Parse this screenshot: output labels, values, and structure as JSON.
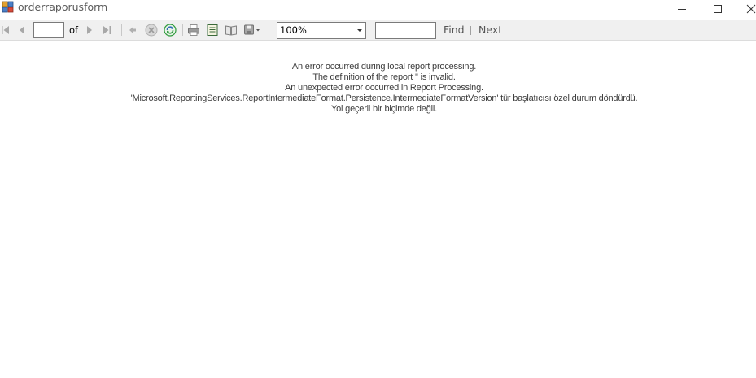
{
  "window": {
    "title": "orderraporusform",
    "icon": "form-app-icon",
    "controls": [
      "minimize-icon",
      "maximize-icon",
      "close-icon"
    ]
  },
  "toolbar": {
    "page_value": "",
    "of_label": "of",
    "zoom_value": "100%",
    "find_value": "",
    "find_label": "Find",
    "next_label": "Next",
    "icons": [
      "first-page-icon",
      "previous-page-icon",
      "next-page-icon",
      "last-page-icon",
      "back-icon",
      "stop-icon",
      "refresh-icon",
      "print-icon",
      "print-layout-icon",
      "page-setup-icon",
      "export-icon"
    ]
  },
  "report": {
    "error_lines": [
      "An error occurred during local report processing.",
      "The definition of the report '' is invalid.",
      "An unexpected error occurred in Report Processing.",
      "'Microsoft.ReportingServices.ReportIntermediateFormat.Persistence.IntermediateFormatVersion' tür başlatıcısı özel durum döndürdü.",
      "Yol geçerli bir biçimde değil."
    ]
  },
  "colors": {
    "toolbar_bg": "#f0f0f0",
    "error_text": "#3c3c3c",
    "refresh_green": "#2e9a3c",
    "refresh_blue": "#2f6db5"
  }
}
